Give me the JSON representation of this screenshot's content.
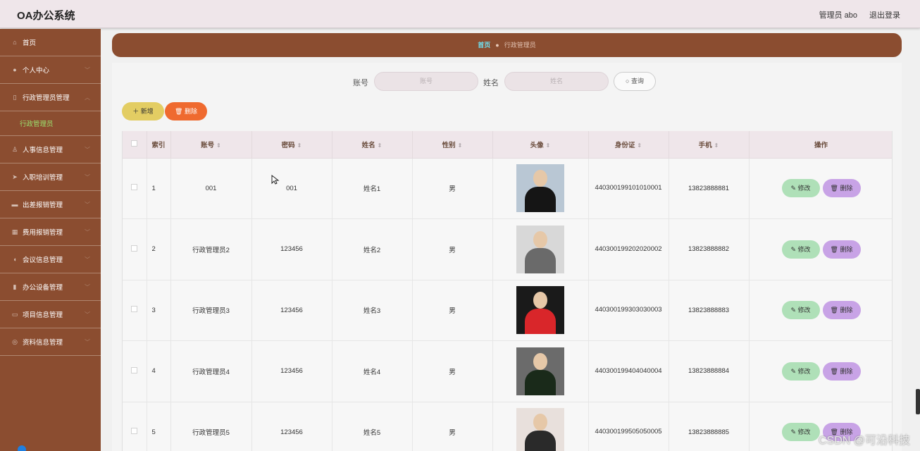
{
  "header": {
    "title": "OA办公系统",
    "user": "管理员 abo",
    "logout": "退出登录"
  },
  "sidebar": {
    "items": [
      {
        "label": "首页",
        "icon": "home-icon"
      },
      {
        "label": "个人中心",
        "icon": "user-icon"
      },
      {
        "label": "行政管理员管理",
        "icon": "phone-icon"
      },
      {
        "label": "人事信息管理",
        "icon": "person-icon"
      },
      {
        "label": "入职培训管理",
        "icon": "send-icon"
      },
      {
        "label": "出差报销管理",
        "icon": "briefcase-icon"
      },
      {
        "label": "费用报销管理",
        "icon": "book-icon"
      },
      {
        "label": "会议信息管理",
        "icon": "mic-icon"
      },
      {
        "label": "办公设备管理",
        "icon": "device-icon"
      },
      {
        "label": "项目信息管理",
        "icon": "monitor-icon"
      },
      {
        "label": "资料信息管理",
        "icon": "compass-icon"
      }
    ],
    "submenu": "行政管理员"
  },
  "breadcrumb": {
    "home": "首页",
    "current": "行政管理员"
  },
  "search": {
    "account_label": "账号",
    "account_placeholder": "账号",
    "name_label": "姓名",
    "name_placeholder": "姓名",
    "query_button": "查询"
  },
  "actions": {
    "add": "新增",
    "delete": "删除"
  },
  "table": {
    "headers": [
      "索引",
      "账号",
      "密码",
      "姓名",
      "性别",
      "头像",
      "身份证",
      "手机",
      "操作"
    ],
    "rows": [
      {
        "index": "1",
        "account": "001",
        "password": "001",
        "name": "姓名1",
        "gender": "男",
        "idcard": "440300199101010001",
        "phone": "13823888881"
      },
      {
        "index": "2",
        "account": "行政管理员2",
        "password": "123456",
        "name": "姓名2",
        "gender": "男",
        "idcard": "440300199202020002",
        "phone": "13823888882"
      },
      {
        "index": "3",
        "account": "行政管理员3",
        "password": "123456",
        "name": "姓名3",
        "gender": "男",
        "idcard": "440300199303030003",
        "phone": "13823888883"
      },
      {
        "index": "4",
        "account": "行政管理员4",
        "password": "123456",
        "name": "姓名4",
        "gender": "男",
        "idcard": "440300199404040004",
        "phone": "13823888884"
      },
      {
        "index": "5",
        "account": "行政管理员5",
        "password": "123456",
        "name": "姓名5",
        "gender": "男",
        "idcard": "440300199505050005",
        "phone": "13823888885"
      }
    ],
    "edit_label": "修改",
    "delete_label": "删除"
  },
  "watermark": "CSDN @可沿科技",
  "colors": {
    "sidebar": "#8b4d30",
    "header": "#efe6ea",
    "add": "#e3cd63",
    "delete": "#ef6a2f",
    "edit": "#afe0b8",
    "row_delete": "#c8a3e6",
    "active_submenu": "#9be26f"
  }
}
